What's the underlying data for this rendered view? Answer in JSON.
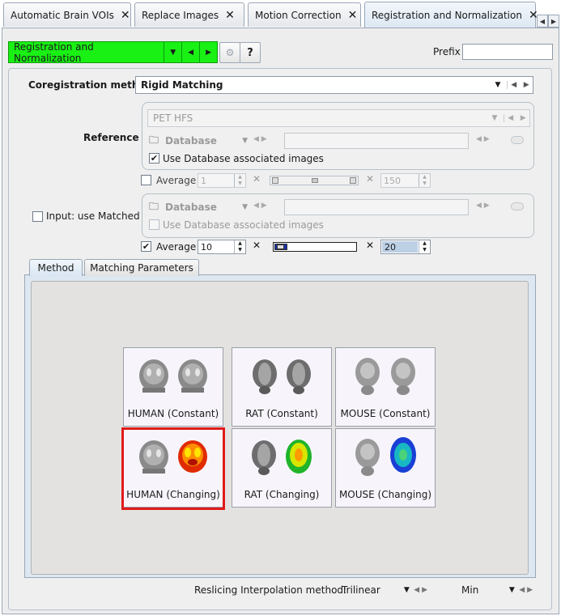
{
  "tabs": [
    {
      "label": "Automatic Brain VOIs",
      "close": "✕"
    },
    {
      "label": "Replace Images",
      "close": "✕"
    },
    {
      "label": "Motion Correction",
      "close": "✕"
    },
    {
      "label": "Registration and Normalization",
      "close": "✕",
      "active": true
    }
  ],
  "toolbar": {
    "workflow": "Registration and Normalization",
    "help": "?",
    "prefix_label": "Prefix",
    "prefix_value": ""
  },
  "coregistration": {
    "label": "Coregistration method",
    "value": "Rigid Matching"
  },
  "reference": {
    "label": "Reference",
    "series": "PET HFS",
    "source": "Database",
    "path": "",
    "use_db_label": "Use Database associated images",
    "use_db_checked": true,
    "average_label": "Average",
    "average_checked": false,
    "avg_from": "1",
    "avg_to": "150",
    "times": "✕"
  },
  "input": {
    "label": "Input: use Matched",
    "checked": false,
    "source": "Database",
    "path": "",
    "use_db_label": "Use Database associated images",
    "use_db_checked": false,
    "average_label": "Average",
    "average_checked": true,
    "avg_from": "10",
    "avg_to": "20",
    "times": "✕"
  },
  "method_tabs": [
    {
      "label": "Method",
      "active": true
    },
    {
      "label": "Matching Parameters",
      "active": false
    }
  ],
  "templates": [
    {
      "label": "HUMAN (Constant)",
      "selected": false
    },
    {
      "label": "RAT (Constant)",
      "selected": false
    },
    {
      "label": "MOUSE (Constant)",
      "selected": false
    },
    {
      "label": "HUMAN (Changing)",
      "selected": true
    },
    {
      "label": "RAT (Changing)",
      "selected": false
    },
    {
      "label": "MOUSE (Changing)",
      "selected": false
    }
  ],
  "reslicing": {
    "label": "Reslicing Interpolation method:",
    "value": "Trilinear",
    "mode": "Min"
  },
  "colors": {
    "green": "#19f014",
    "selection": "#e01b1b",
    "tab_active": "#dde8f4"
  }
}
